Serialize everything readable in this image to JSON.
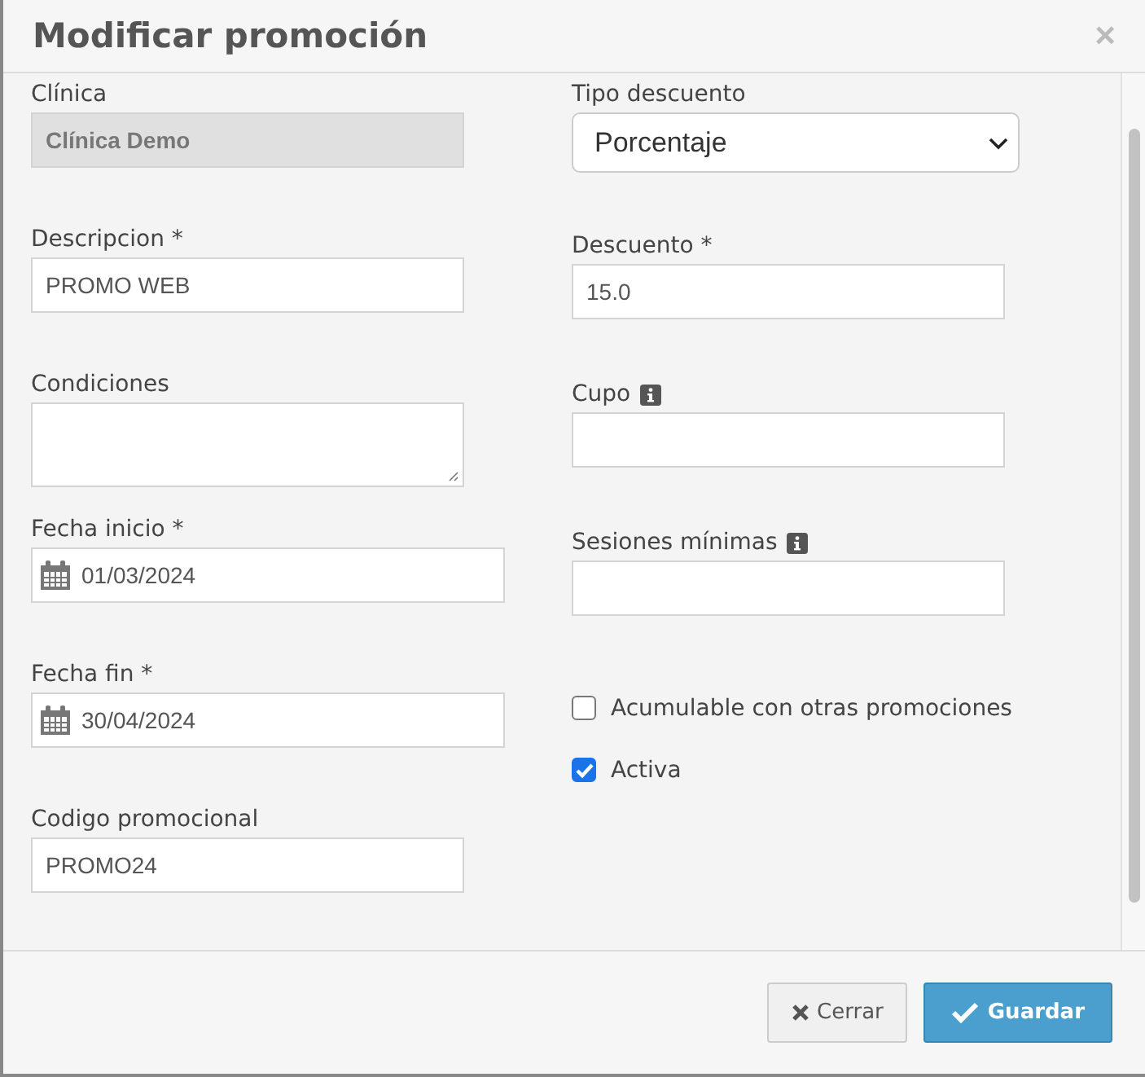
{
  "dialog": {
    "title": "Modificar promoción",
    "close": "×"
  },
  "left_fields": [
    {
      "kind": "text",
      "label": "Clínica",
      "value": "Clínica Demo",
      "disabled": true
    },
    {
      "kind": "text",
      "label": "Descripcion *",
      "value": "PROMO WEB",
      "disabled": false
    },
    {
      "kind": "textarea",
      "label": "Condiciones"
    },
    {
      "kind": "date",
      "label": "Fecha inicio *",
      "value": "01/03/2024"
    },
    {
      "kind": "date",
      "label": "Fecha fin *",
      "value": "30/04/2024"
    },
    {
      "kind": "text",
      "label": "Codigo promocional",
      "value": "PROMO24",
      "disabled": false
    }
  ],
  "right_fields": [
    {
      "kind": "select",
      "label": "Tipo descuento",
      "value": "Porcentaje"
    },
    {
      "kind": "text",
      "label": "Descuento *",
      "value": "15.0",
      "disabled": false
    },
    {
      "kind": "text",
      "label": "Cupo",
      "info": true,
      "disabled": false
    },
    {
      "kind": "text",
      "label": "Sesiones mínimas",
      "info": true,
      "disabled": false
    },
    {
      "kind": "checkbox",
      "label": "Acumulable con otras promociones",
      "checked": false
    },
    {
      "kind": "checkbox",
      "label": "Activa",
      "checked": true
    }
  ],
  "buttons": [
    {
      "kind": "close",
      "label": "Cerrar"
    },
    {
      "kind": "save",
      "label": "Guardar"
    }
  ]
}
